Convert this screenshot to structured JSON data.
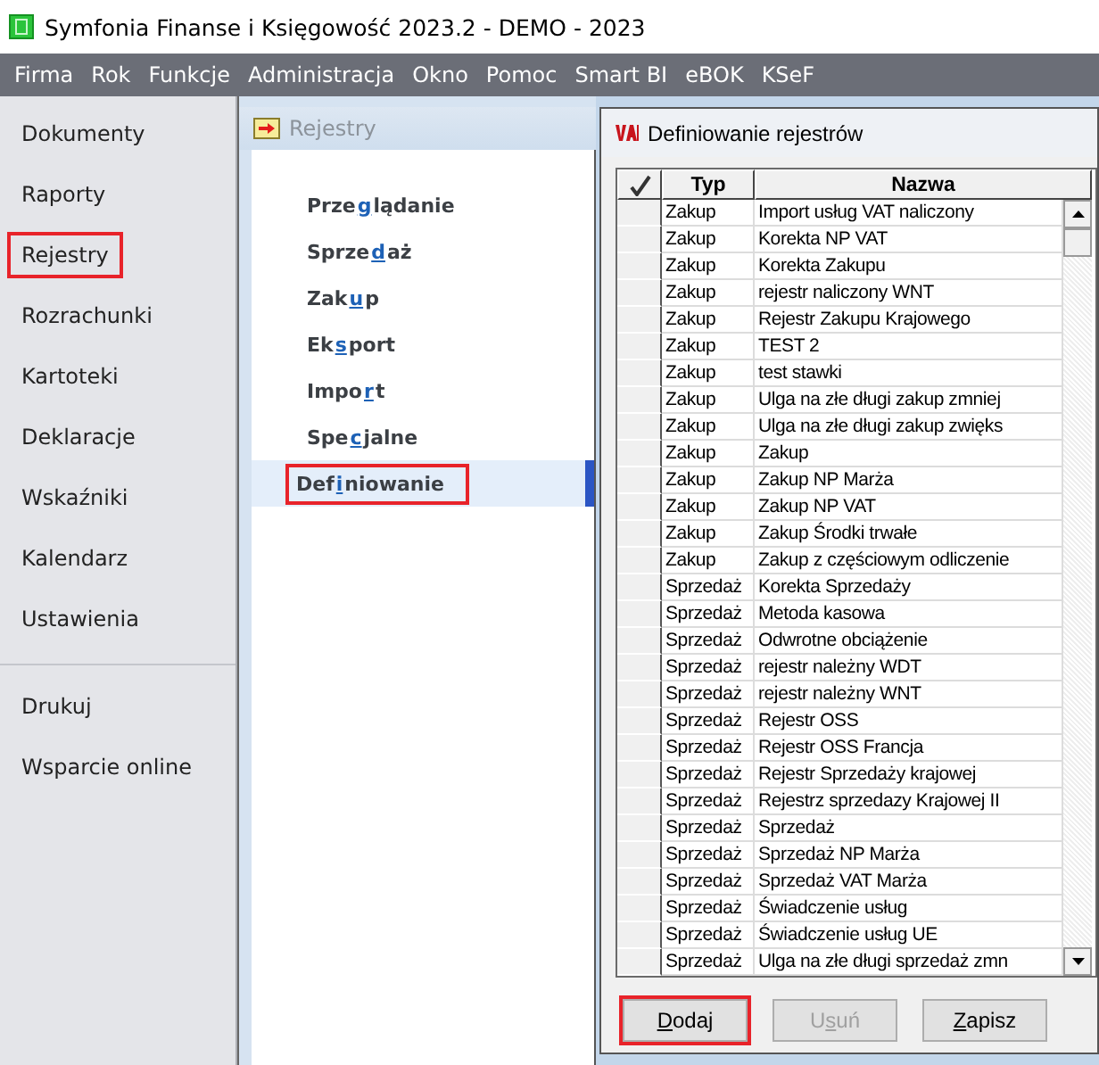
{
  "window": {
    "title": "Symfonia Finanse i Księgowość 2023.2 - DEMO - 2023"
  },
  "menu": [
    "Firma",
    "Rok",
    "Funkcje",
    "Administracja",
    "Okno",
    "Pomoc",
    "Smart BI",
    "eBOK",
    "KSeF"
  ],
  "sidebar": {
    "groups": [
      [
        {
          "label": "Dokumenty",
          "highlighted": false
        },
        {
          "label": "Raporty",
          "highlighted": false
        },
        {
          "label": "Rejestry",
          "highlighted": true
        },
        {
          "label": "Rozrachunki",
          "highlighted": false
        },
        {
          "label": "Kartoteki",
          "highlighted": false
        },
        {
          "label": "Deklaracje",
          "highlighted": false
        },
        {
          "label": "Wskaźniki",
          "highlighted": false
        },
        {
          "label": "Kalendarz",
          "highlighted": false
        },
        {
          "label": "Ustawienia",
          "highlighted": false
        }
      ],
      [
        {
          "label": "Drukuj",
          "highlighted": false
        },
        {
          "label": "Wsparcie online",
          "highlighted": false
        }
      ]
    ]
  },
  "panel": {
    "title": "Rejestry",
    "items": [
      {
        "before": "Prze",
        "key": "g",
        "after": "lądanie",
        "selected": false,
        "highlighted": false
      },
      {
        "before": "Sprze",
        "key": "d",
        "after": "aż",
        "selected": false,
        "highlighted": false
      },
      {
        "before": "Zak",
        "key": "u",
        "after": "p",
        "selected": false,
        "highlighted": false
      },
      {
        "before": "Ek",
        "key": "s",
        "after": "port",
        "selected": false,
        "highlighted": false
      },
      {
        "before": "Impo",
        "key": "r",
        "after": "t",
        "selected": false,
        "highlighted": false
      },
      {
        "before": "Spe",
        "key": "c",
        "after": "jalne",
        "selected": false,
        "highlighted": false
      },
      {
        "before": "Def",
        "key": "i",
        "after": "niowanie",
        "selected": true,
        "highlighted": true
      }
    ]
  },
  "dialog": {
    "title": "Definiowanie rejestrów",
    "columns": [
      "Typ",
      "Nazwa"
    ],
    "rows": [
      [
        "Zakup",
        "Import usług VAT naliczony"
      ],
      [
        "Zakup",
        "Korekta NP VAT"
      ],
      [
        "Zakup",
        "Korekta Zakupu"
      ],
      [
        "Zakup",
        "rejestr naliczony WNT"
      ],
      [
        "Zakup",
        "Rejestr Zakupu Krajowego"
      ],
      [
        "Zakup",
        "TEST 2"
      ],
      [
        "Zakup",
        "test stawki"
      ],
      [
        "Zakup",
        "Ulga na złe długi zakup zmniej"
      ],
      [
        "Zakup",
        "Ulga na złe długi zakup zwięks"
      ],
      [
        "Zakup",
        "Zakup"
      ],
      [
        "Zakup",
        "Zakup NP Marża"
      ],
      [
        "Zakup",
        "Zakup NP VAT"
      ],
      [
        "Zakup",
        "Zakup Środki trwałe"
      ],
      [
        "Zakup",
        "Zakup z częściowym odliczenie"
      ],
      [
        "Sprzedaż",
        "Korekta Sprzedaży"
      ],
      [
        "Sprzedaż",
        "Metoda kasowa"
      ],
      [
        "Sprzedaż",
        "Odwrotne obciążenie"
      ],
      [
        "Sprzedaż",
        "rejestr należny WDT"
      ],
      [
        "Sprzedaż",
        "rejestr należny WNT"
      ],
      [
        "Sprzedaż",
        "Rejestr OSS"
      ],
      [
        "Sprzedaż",
        "Rejestr OSS Francja"
      ],
      [
        "Sprzedaż",
        "Rejestr Sprzedaży krajowej"
      ],
      [
        "Sprzedaż",
        "Rejestrz sprzedazy Krajowej II"
      ],
      [
        "Sprzedaż",
        "Sprzedaż"
      ],
      [
        "Sprzedaż",
        "Sprzedaż NP Marża"
      ],
      [
        "Sprzedaż",
        "Sprzedaż VAT Marża"
      ],
      [
        "Sprzedaż",
        "Świadczenie usług"
      ],
      [
        "Sprzedaż",
        "Świadczenie usług UE"
      ],
      [
        "Sprzedaż",
        "Ulga na złe długi sprzedaż zmn"
      ]
    ],
    "buttons": [
      {
        "key": "D",
        "after": "odaj",
        "disabled": false,
        "highlighted": true
      },
      {
        "before": "U",
        "key": "s",
        "after": "uń",
        "disabled": true,
        "highlighted": false
      },
      {
        "key": "Z",
        "after": "apisz",
        "disabled": false,
        "highlighted": false
      }
    ]
  }
}
